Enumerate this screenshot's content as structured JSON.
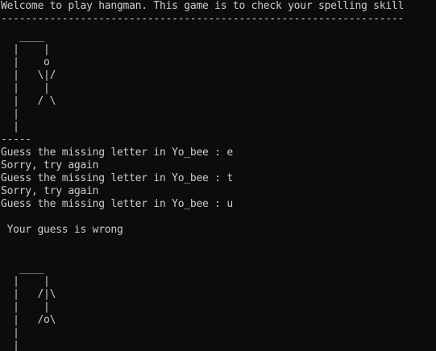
{
  "terminal": {
    "background": "#0c0c0c",
    "foreground": "#cccccc",
    "welcome": "Welcome to play hangman. This game is to check your spelling skill",
    "separator": "------------------------------------------------------------------",
    "hangman_1": "   ____\n  |    |\n  |    o\n  |   \\|/\n  |    |\n  |   / \\\n  |\n  |\n-----",
    "guesses": [
      "Guess the missing letter in Yo_bee : e",
      "Sorry, try again",
      "Guess the missing letter in Yo_bee : t",
      "Sorry, try again",
      "Guess the missing letter in Yo_bee : u"
    ],
    "result": " Your guess is wrong",
    "hangman_2": "   ____\n  |    |\n  |   /|\\\n  |    |\n  |   /o\\\n  |\n  |\n-----"
  }
}
